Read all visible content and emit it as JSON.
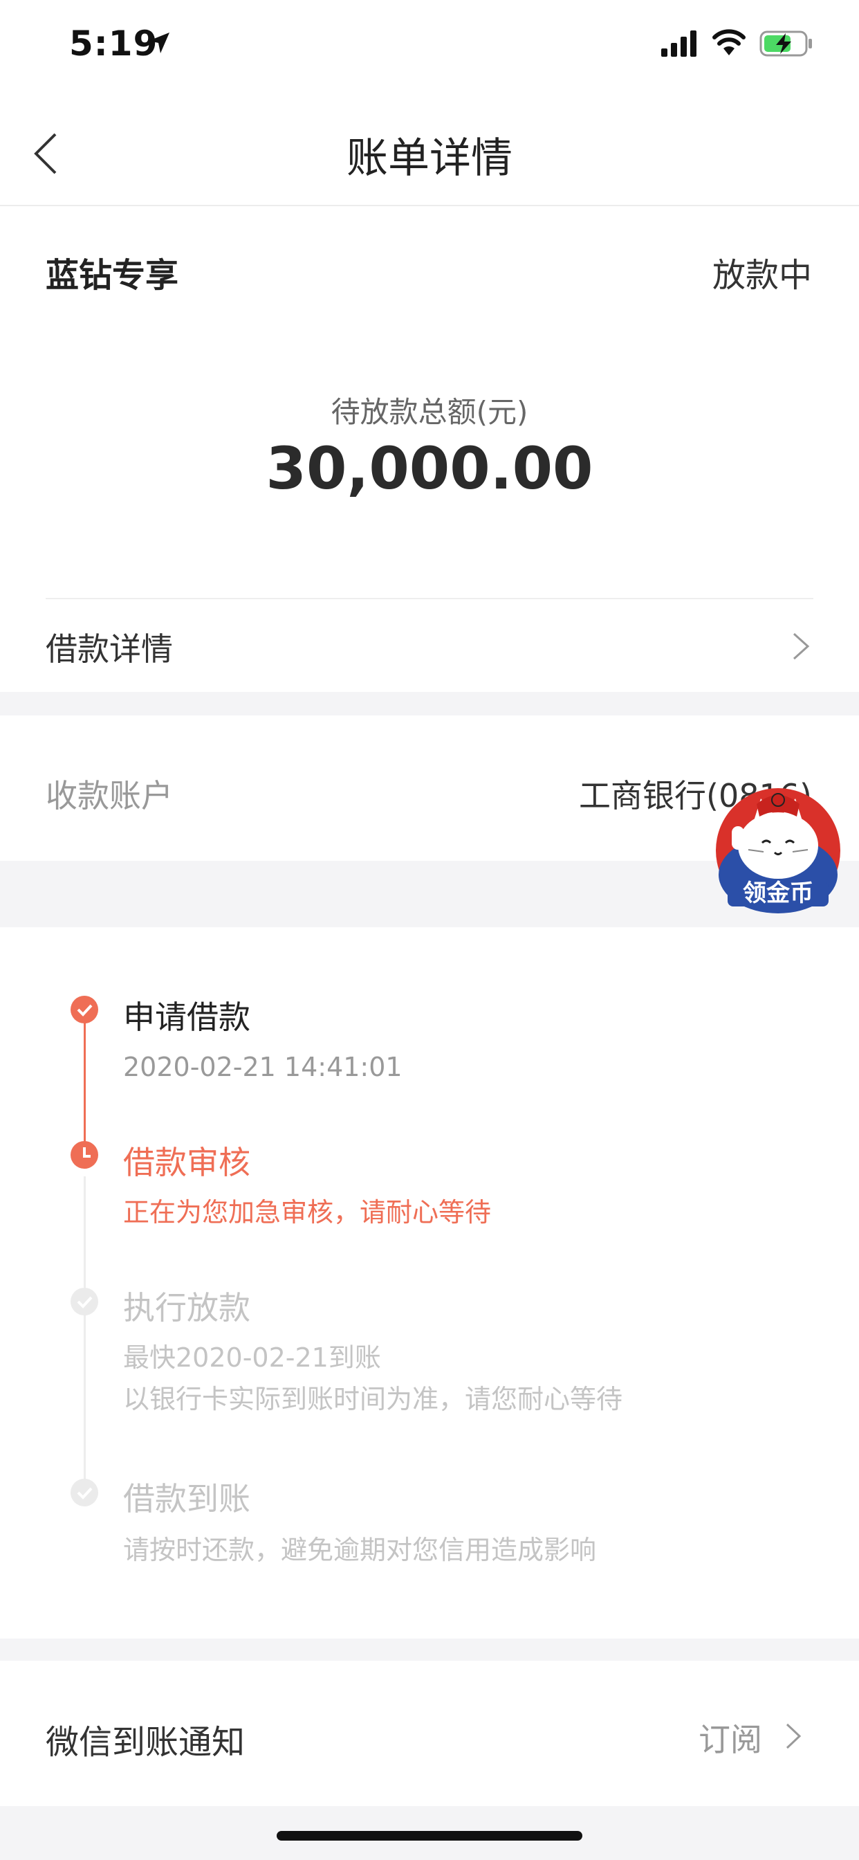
{
  "status_bar": {
    "time": "5:19"
  },
  "nav": {
    "title": "账单详情"
  },
  "summary": {
    "product": "蓝钻专享",
    "status": "放款中",
    "amount_label": "待放款总额(元)",
    "amount": "30,000.00",
    "detail_row": "借款详情"
  },
  "account": {
    "label": "收款账户",
    "value": "工商银行(0816)",
    "badge_text": "领金币"
  },
  "timeline": {
    "steps": [
      {
        "title": "申请借款",
        "desc": "2020-02-21 14:41:01",
        "state": "done"
      },
      {
        "title": "借款审核",
        "desc": "正在为您加急审核，请耐心等待",
        "state": "current"
      },
      {
        "title": "执行放款",
        "desc1": "最快2020-02-21到账",
        "desc2": "以银行卡实际到账时间为准，请您耐心等待",
        "state": "pending"
      },
      {
        "title": "借款到账",
        "desc": "请按时还款，避免逾期对您信用造成影响",
        "state": "pending"
      }
    ]
  },
  "notify": {
    "label": "微信到账通知",
    "action": "订阅"
  },
  "colors": {
    "accent": "#ef6e55",
    "pending": "#d8d8d8",
    "muted": "#999999"
  }
}
